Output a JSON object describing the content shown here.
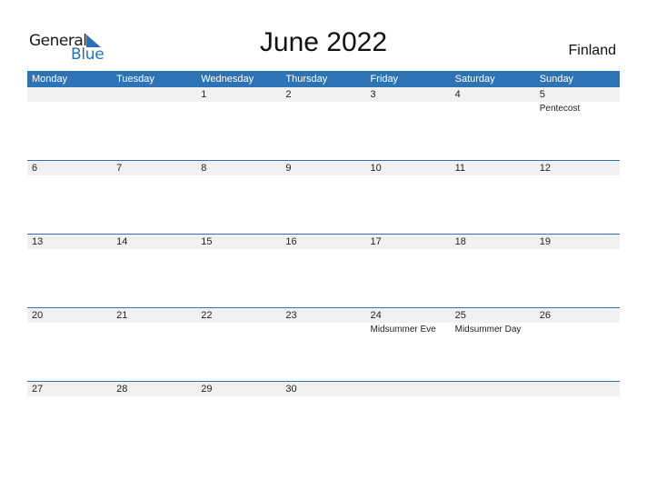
{
  "logo": {
    "line1": "General",
    "line2": "Blue"
  },
  "title": "June 2022",
  "country": "Finland",
  "colors": {
    "accent": "#2e74b5",
    "row_shade": "#f1f1f1"
  },
  "weekdays": [
    "Monday",
    "Tuesday",
    "Wednesday",
    "Thursday",
    "Friday",
    "Saturday",
    "Sunday"
  ],
  "weeks": [
    {
      "days": [
        {
          "num": "",
          "holiday": ""
        },
        {
          "num": "",
          "holiday": ""
        },
        {
          "num": "1",
          "holiday": ""
        },
        {
          "num": "2",
          "holiday": ""
        },
        {
          "num": "3",
          "holiday": ""
        },
        {
          "num": "4",
          "holiday": ""
        },
        {
          "num": "5",
          "holiday": "Pentecost"
        }
      ]
    },
    {
      "days": [
        {
          "num": "6",
          "holiday": ""
        },
        {
          "num": "7",
          "holiday": ""
        },
        {
          "num": "8",
          "holiday": ""
        },
        {
          "num": "9",
          "holiday": ""
        },
        {
          "num": "10",
          "holiday": ""
        },
        {
          "num": "11",
          "holiday": ""
        },
        {
          "num": "12",
          "holiday": ""
        }
      ]
    },
    {
      "days": [
        {
          "num": "13",
          "holiday": ""
        },
        {
          "num": "14",
          "holiday": ""
        },
        {
          "num": "15",
          "holiday": ""
        },
        {
          "num": "16",
          "holiday": ""
        },
        {
          "num": "17",
          "holiday": ""
        },
        {
          "num": "18",
          "holiday": ""
        },
        {
          "num": "19",
          "holiday": ""
        }
      ]
    },
    {
      "days": [
        {
          "num": "20",
          "holiday": ""
        },
        {
          "num": "21",
          "holiday": ""
        },
        {
          "num": "22",
          "holiday": ""
        },
        {
          "num": "23",
          "holiday": ""
        },
        {
          "num": "24",
          "holiday": "Midsummer Eve"
        },
        {
          "num": "25",
          "holiday": "Midsummer Day"
        },
        {
          "num": "26",
          "holiday": ""
        }
      ]
    },
    {
      "days": [
        {
          "num": "27",
          "holiday": ""
        },
        {
          "num": "28",
          "holiday": ""
        },
        {
          "num": "29",
          "holiday": ""
        },
        {
          "num": "30",
          "holiday": ""
        },
        {
          "num": "",
          "holiday": ""
        },
        {
          "num": "",
          "holiday": ""
        },
        {
          "num": "",
          "holiday": ""
        }
      ]
    }
  ]
}
